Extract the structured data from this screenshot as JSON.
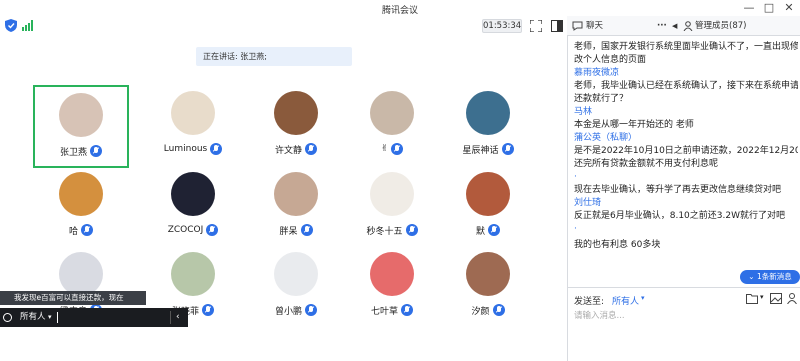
{
  "window": {
    "title": "腾讯会议"
  },
  "toolbar": {
    "timer": "01:53:34"
  },
  "meeting": {
    "speaking": "正在讲话: 张卫燕;"
  },
  "participants": [
    {
      "name": "张卫燕",
      "color": "#d7c3b6",
      "selected": true
    },
    {
      "name": "Luminous",
      "color": "#e8dccb"
    },
    {
      "name": "许文静",
      "color": "#8a5a3c"
    },
    {
      "name": "✌",
      "color": "#c9b8a8"
    },
    {
      "name": "星辰神话",
      "color": "#3d6f8f"
    },
    {
      "name": "哈",
      "color": "#d4903e"
    },
    {
      "name": "ZCOCOJ",
      "color": "#1f2233"
    },
    {
      "name": "胖呆",
      "color": "#c6a894"
    },
    {
      "name": "秒冬十五",
      "color": "#f0ece6"
    },
    {
      "name": "默",
      "color": "#b25a3c"
    },
    {
      "name": "梁丰良",
      "color": "#d9dbe2"
    },
    {
      "name": "张晓菲",
      "color": "#b7c7a9"
    },
    {
      "name": "曾小鹏",
      "color": "#e9ebee"
    },
    {
      "name": "七叶草",
      "color": "#e66b6b"
    },
    {
      "name": "汐颜",
      "color": "#9e6a52"
    }
  ],
  "popup": {
    "message": "我发现e百富可以直接还款，现在",
    "recipient": "所有人"
  },
  "chat": {
    "tab_chat": "聊天",
    "tab_more": "···",
    "tab_members": "管理成员(87)",
    "messages": [
      {
        "type": "text",
        "text": "老师，国家开发银行系统里面毕业确认不了，一直出现修"
      },
      {
        "type": "text",
        "text": "改个人信息的页面"
      },
      {
        "type": "sender",
        "text": "慕雨夜微凉"
      },
      {
        "type": "text",
        "text": "老师，我毕业确认已经在系统确认了，接下来在系统申请"
      },
      {
        "type": "text",
        "text": "还款就行了？"
      },
      {
        "type": "sender",
        "text": "马林"
      },
      {
        "type": "text",
        "text": "本金是从哪一年开始还的  老师"
      },
      {
        "type": "sender",
        "text": "蒲公英（私聊）"
      },
      {
        "type": "text",
        "text": "是不是2022年10月10日之前申请还款，2022年12月20日"
      },
      {
        "type": "text",
        "text": "还完所有贷款金额就不用支付利息呢"
      },
      {
        "type": "sender",
        "text": "·"
      },
      {
        "type": "text",
        "text": "现在去毕业确认，等升学了再去更改信息继续贷对吧"
      },
      {
        "type": "sender",
        "text": "刘仕琦"
      },
      {
        "type": "text",
        "text": "反正就是6月毕业确认，8.10之前还3.2W就行了对吧"
      },
      {
        "type": "sender",
        "text": "·"
      },
      {
        "type": "text",
        "text": "我的也有利息 60多块"
      }
    ],
    "new_messages": "1条新消息",
    "send_to_label": "发送至:",
    "send_to_value": "所有人",
    "input_placeholder": "请输入消息..."
  }
}
